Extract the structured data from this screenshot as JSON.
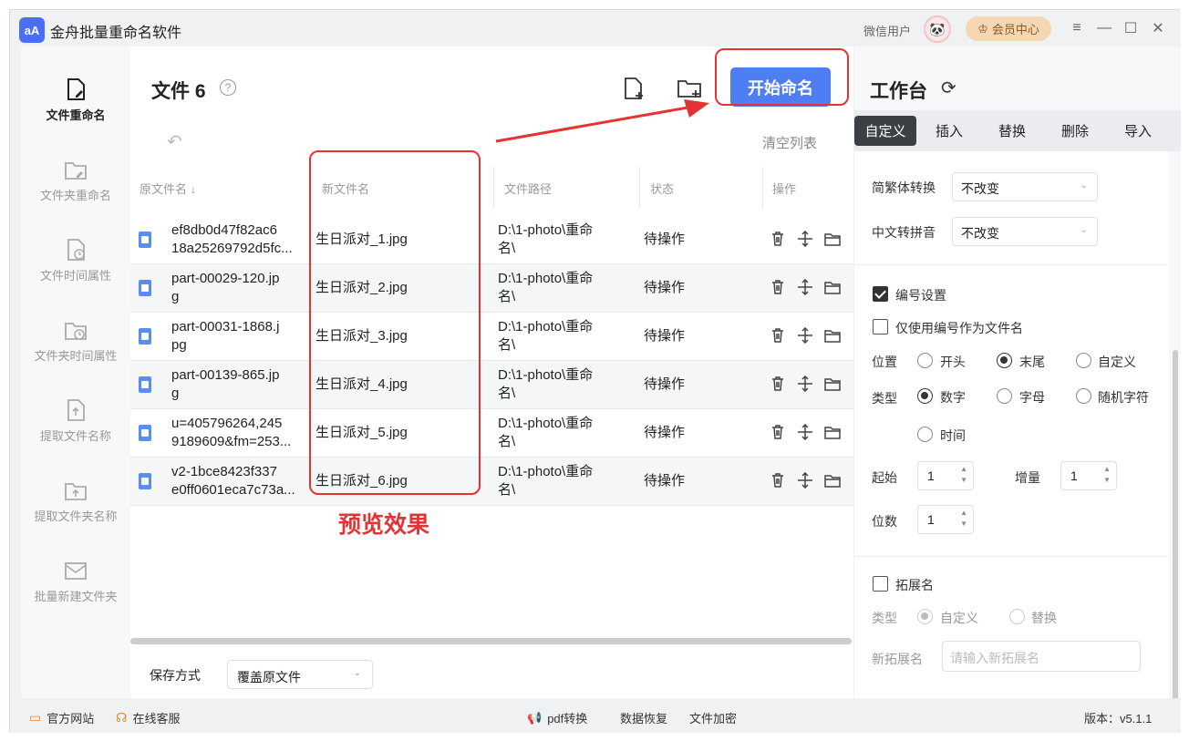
{
  "app": {
    "title": "金舟批量重命名软件",
    "logo_text": "aA",
    "user_name": "微信用户",
    "vip_label": "会员中心"
  },
  "window_controls": {
    "menu": "≡",
    "minimize": "—",
    "maximize": "☐",
    "close": "✕"
  },
  "sidebar": {
    "items": [
      {
        "label": "文件重命名",
        "icon": "file-edit-icon",
        "active": true
      },
      {
        "label": "文件夹重命名",
        "icon": "folder-edit-icon"
      },
      {
        "label": "文件时间属性",
        "icon": "file-clock-icon"
      },
      {
        "label": "文件夹时间属性",
        "icon": "folder-clock-icon"
      },
      {
        "label": "提取文件名称",
        "icon": "file-export-icon"
      },
      {
        "label": "提取文件夹名称",
        "icon": "folder-export-icon"
      },
      {
        "label": "批量新建文件夹",
        "icon": "folder-mail-icon"
      }
    ]
  },
  "main": {
    "files_label": "文件 6",
    "help": "?",
    "start_button": "开始命名",
    "clear_list": "清空列表",
    "undo": "↶",
    "columns": {
      "original": "原文件名 ↓",
      "new": "新文件名",
      "path": "文件路径",
      "status": "状态",
      "ops": "操作"
    },
    "rows": [
      {
        "orig1": "ef8db0d47f82ac6",
        "orig2": "18a25269792d5fc...",
        "new": "生日派对_1.jpg",
        "path1": "D:\\1-photo\\重命",
        "path2": "名\\",
        "status": "待操作"
      },
      {
        "orig1": "part-00029-120.jp",
        "orig2": "g",
        "new": "生日派对_2.jpg",
        "path1": "D:\\1-photo\\重命",
        "path2": "名\\",
        "status": "待操作"
      },
      {
        "orig1": "part-00031-1868.j",
        "orig2": "pg",
        "new": "生日派对_3.jpg",
        "path1": "D:\\1-photo\\重命",
        "path2": "名\\",
        "status": "待操作"
      },
      {
        "orig1": "part-00139-865.jp",
        "orig2": "g",
        "new": "生日派对_4.jpg",
        "path1": "D:\\1-photo\\重命",
        "path2": "名\\",
        "status": "待操作"
      },
      {
        "orig1": "u=405796264,245",
        "orig2": "9189609&fm=253...",
        "new": "生日派对_5.jpg",
        "path1": "D:\\1-photo\\重命",
        "path2": "名\\",
        "status": "待操作"
      },
      {
        "orig1": "v2-1bce8423f337",
        "orig2": "e0ff0601eca7c73a...",
        "new": "生日派对_6.jpg",
        "path1": "D:\\1-photo\\重命",
        "path2": "名\\",
        "status": "待操作"
      }
    ],
    "save_label": "保存方式",
    "save_value": "覆盖原文件",
    "annotation_label": "预览效果"
  },
  "panel": {
    "title": "工作台",
    "tabs": [
      "自定义",
      "插入",
      "替换",
      "删除",
      "导入"
    ],
    "trad_simp_label": "简繁体转换",
    "trad_simp_value": "不改变",
    "pinyin_label": "中文转拼音",
    "pinyin_value": "不改变",
    "numbering_label": "编号设置",
    "only_number_label": "仅使用编号作为文件名",
    "position_label": "位置",
    "position_options": [
      "开头",
      "末尾",
      "自定义"
    ],
    "type_label": "类型",
    "type_options": [
      "数字",
      "字母",
      "随机字符",
      "时间"
    ],
    "start_label": "起始",
    "start_value": "1",
    "step_label": "增量",
    "step_value": "1",
    "digits_label": "位数",
    "digits_value": "1",
    "ext_label": "拓展名",
    "ext_type_label": "类型",
    "ext_type_options": [
      "自定义",
      "替换"
    ],
    "new_ext_label": "新拓展名",
    "new_ext_placeholder": "请输入新拓展名"
  },
  "footer": {
    "website": "官方网站",
    "support": "在线客服",
    "pdf": "pdf转换",
    "recover": "数据恢复",
    "encrypt": "文件加密",
    "version": "版本：v5.1.1"
  },
  "colors": {
    "accent": "#4f7df3",
    "annotation": "#e23434",
    "active_tab": "#3c3f44"
  }
}
